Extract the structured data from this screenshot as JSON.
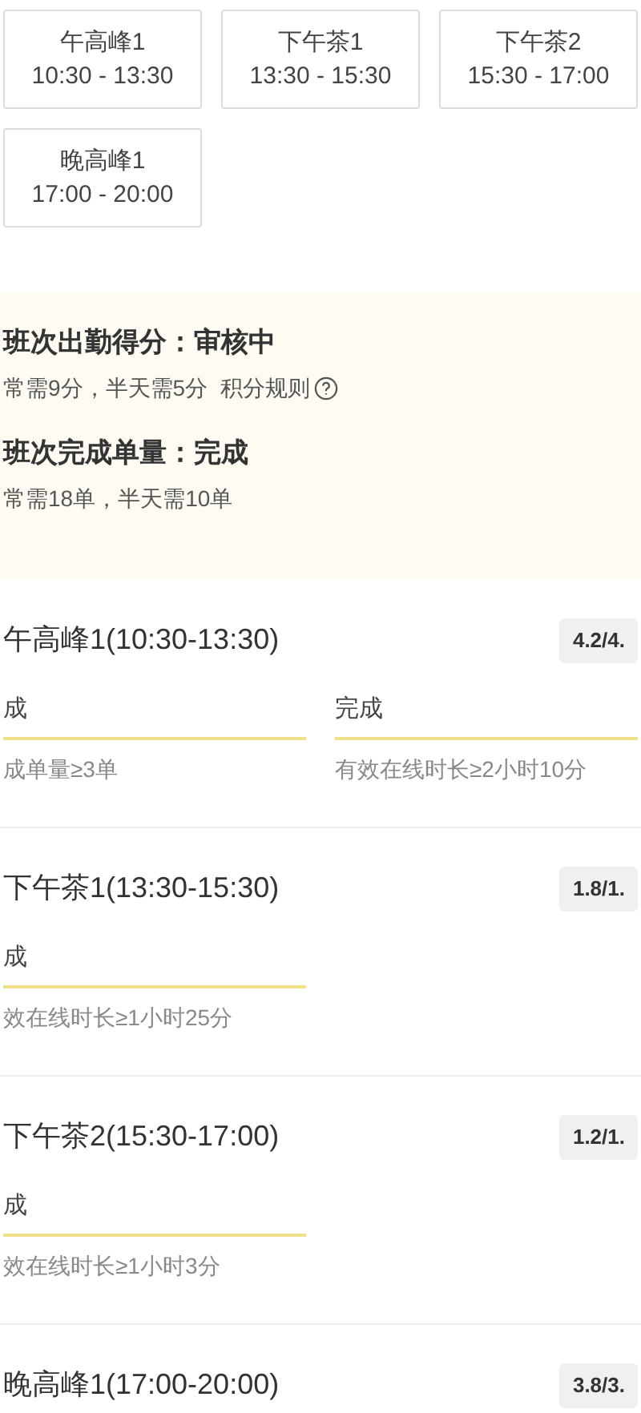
{
  "shift_tabs": [
    {
      "name": "午高峰1",
      "time": "10:30 - 13:30"
    },
    {
      "name": "下午茶1",
      "time": "13:30 - 15:30"
    },
    {
      "name": "下午茶2",
      "time": "15:30 - 17:00"
    },
    {
      "name": "晚高峰1",
      "time": "17:00 - 20:00"
    }
  ],
  "summary": [
    {
      "title": "班次出勤得分：审核中",
      "note": "常需9分，半天需5分",
      "link": "积分规则"
    },
    {
      "title": "班次完成单量：完成",
      "note": "常需18单，半天需10单"
    }
  ],
  "shifts": [
    {
      "title": "午高峰1(10:30-13:30)",
      "score": "4.2/4.",
      "criteria": [
        {
          "status": "成",
          "hint": "成单量≥3单"
        },
        {
          "status": "完成",
          "hint": "有效在线时长≥2小时10分"
        }
      ]
    },
    {
      "title": "下午茶1(13:30-15:30)",
      "score": "1.8/1.",
      "criteria": [
        {
          "status": "成",
          "hint": "效在线时长≥1小时25分"
        }
      ]
    },
    {
      "title": "下午茶2(15:30-17:00)",
      "score": "1.2/1.",
      "criteria": [
        {
          "status": "成",
          "hint": "效在线时长≥1小时3分"
        }
      ]
    },
    {
      "title": "晚高峰1(17:00-20:00)",
      "score": "3.8/3."
    }
  ]
}
